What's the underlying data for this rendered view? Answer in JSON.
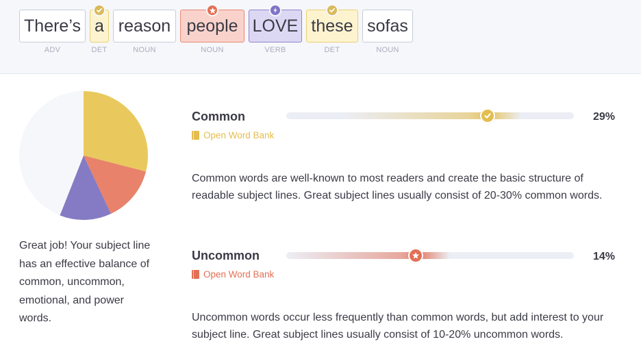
{
  "subject_line": {
    "words": [
      {
        "text": "There’s",
        "pos": "ADV",
        "category": "none",
        "icon": ""
      },
      {
        "text": "a",
        "pos": "DET",
        "category": "common",
        "icon": "check-icon"
      },
      {
        "text": "reason",
        "pos": "NOUN",
        "category": "none",
        "icon": ""
      },
      {
        "text": "people",
        "pos": "NOUN",
        "category": "uncommon",
        "icon": "star-icon"
      },
      {
        "text": "LOVE",
        "pos": "VERB",
        "category": "power",
        "icon": "lightning-icon"
      },
      {
        "text": "these",
        "pos": "DET",
        "category": "common",
        "icon": "check-icon"
      },
      {
        "text": "sofas",
        "pos": "NOUN",
        "category": "none",
        "icon": ""
      }
    ]
  },
  "pie_chart": {
    "slices": [
      {
        "name": "common",
        "value": 29,
        "color": "#e9c95e"
      },
      {
        "name": "uncommon",
        "value": 14,
        "color": "#e8826a"
      },
      {
        "name": "power",
        "value": 13,
        "color": "#857bc4"
      },
      {
        "name": "other",
        "value": 44,
        "color": "#f6f7fb"
      }
    ]
  },
  "summary_text": "Great job! Your subject line has an effective balance of common, uncommon, emotional, and power words.",
  "metrics": {
    "common": {
      "title": "Common",
      "percent_label": "29%",
      "level": 0.7,
      "link_label": "Open Word Bank",
      "color": "#e4bd4f",
      "description": "Common words are well-known to most readers and create the basic structure of readable subject lines. Great subject lines usually consist of 20-30% common words."
    },
    "uncommon": {
      "title": "Uncommon",
      "percent_label": "14%",
      "level": 0.45,
      "link_label": "Open Word Bank",
      "color": "#e36f55",
      "description": "Uncommon words occur less frequently than common words, but add interest to your subject line. Great subject lines usually consist of 10-20% uncommon words."
    }
  }
}
